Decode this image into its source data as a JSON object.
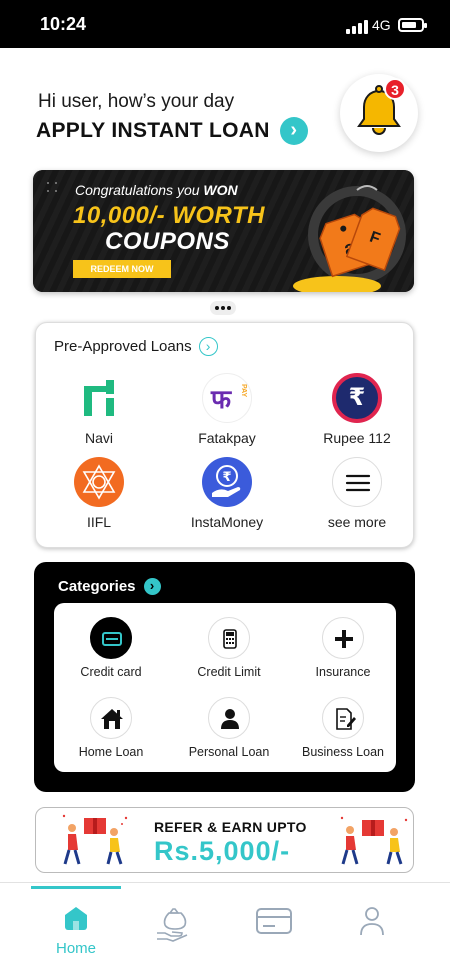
{
  "status_bar": {
    "time": "10:24",
    "network": "4G",
    "battery_level": 0.75
  },
  "header": {
    "greeting": "Hi user, how’s your day",
    "title": "APPLY INSTANT LOAN",
    "notification_count": "3",
    "icons": {
      "arrow": "chevron-right-icon",
      "bell": "bell-icon"
    }
  },
  "banner": {
    "line1_prefix": "Congratulations you ",
    "line1_bold": "WON",
    "line2": "10,000/- WORTH",
    "line3": "COUPONS",
    "button_label": "REDEEM NOW",
    "tag_letters": [
      "a",
      "F"
    ],
    "colors": {
      "yellow": "#f7c31a",
      "tag_orange": "#f27a1a",
      "background": "#1a1a1a"
    },
    "pager": {
      "count": 3,
      "active": 0
    }
  },
  "preapproved": {
    "title": "Pre-Approved Loans",
    "lenders": [
      {
        "label": "Navi",
        "icon": "navi-logo-icon",
        "color": "#1fba80"
      },
      {
        "label": "Fatakpay",
        "icon": "fatakpay-logo-icon",
        "logo_text": "फ",
        "logo_sub": "PAY",
        "color": "#6a2bb0"
      },
      {
        "label": "Rupee 112",
        "icon": "rupee-112-logo-icon",
        "logo_text": "₹",
        "color": "#e0254f"
      },
      {
        "label": "IIFL",
        "icon": "iifl-logo-icon",
        "color": "#f26b21"
      },
      {
        "label": "InstaMoney",
        "icon": "instamoney-logo-icon",
        "logo_text": "₹",
        "color": "#3b5bdb"
      },
      {
        "label": "see more",
        "icon": "menu-icon",
        "color": "#111111"
      }
    ]
  },
  "categories": {
    "title": "Categories",
    "items": [
      {
        "label": "Credit card",
        "icon": "credit-card-icon"
      },
      {
        "label": "Credit Limit",
        "icon": "calculator-icon"
      },
      {
        "label": "Insurance",
        "icon": "plus-icon"
      },
      {
        "label": "Home Loan",
        "icon": "home-icon"
      },
      {
        "label": "Personal Loan",
        "icon": "person-icon"
      },
      {
        "label": "Business Loan",
        "icon": "document-edit-icon"
      }
    ]
  },
  "referral": {
    "line1": "REFER & EARN UPTO",
    "line2": "Rs.5,000/-",
    "illustration": "gift-people-illustration"
  },
  "bottom_nav": {
    "items": [
      {
        "label": "Home",
        "icon": "home-icon",
        "active": true
      },
      {
        "label": "",
        "icon": "money-bag-hand-icon",
        "active": false
      },
      {
        "label": "",
        "icon": "card-icon",
        "active": false
      },
      {
        "label": "",
        "icon": "profile-icon",
        "active": false
      }
    ],
    "accent_color": "#34c6c9"
  }
}
